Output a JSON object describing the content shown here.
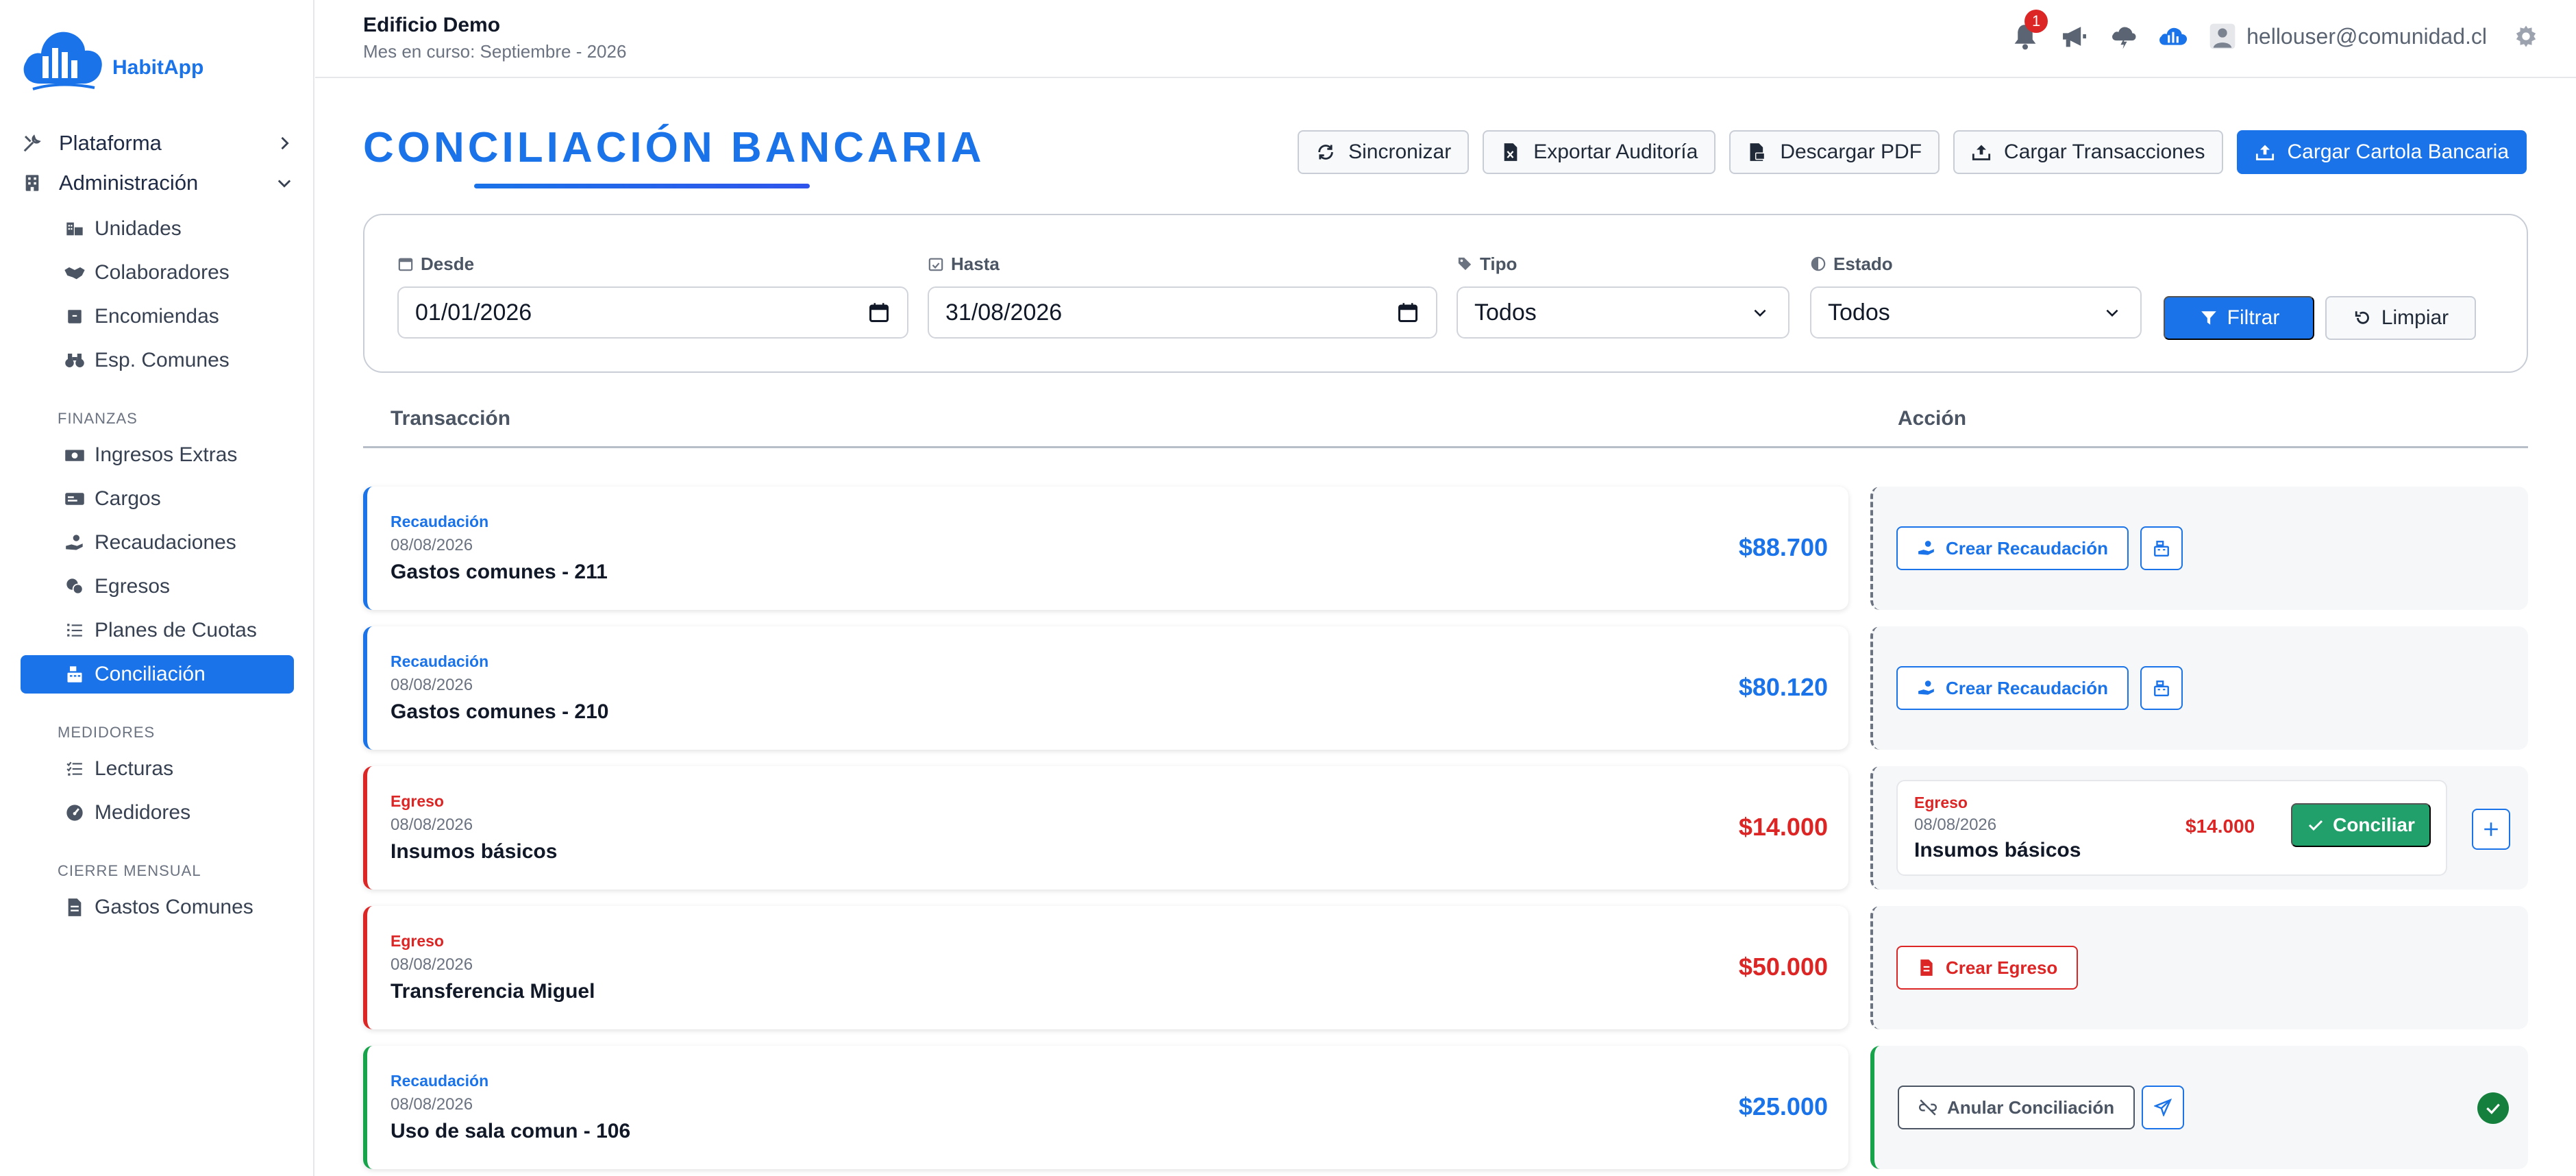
{
  "app": {
    "logo_text": "HabitApp",
    "brand_color": "#1a73e8"
  },
  "header": {
    "building": "Edificio Demo",
    "current_month": "Mes en curso: Septiembre - 2026",
    "notifications_count": "1",
    "user_email": "hellouser@comunidad.cl"
  },
  "sidebar": {
    "top": [
      {
        "label": "Plataforma",
        "icon": "tools-icon",
        "state": "collapsed"
      },
      {
        "label": "Administración",
        "icon": "building-icon",
        "state": "expanded"
      }
    ],
    "admin_items": [
      {
        "label": "Unidades",
        "icon": "units-icon"
      },
      {
        "label": "Colaboradores",
        "icon": "handshake-icon"
      },
      {
        "label": "Encomiendas",
        "icon": "package-icon"
      },
      {
        "label": "Esp. Comunes",
        "icon": "binoculars-icon"
      }
    ],
    "finanzas_label": "FINANZAS",
    "finanzas_items": [
      {
        "label": "Ingresos Extras",
        "icon": "money-icon"
      },
      {
        "label": "Cargos",
        "icon": "card-icon"
      },
      {
        "label": "Recaudaciones",
        "icon": "hand-coin-icon"
      },
      {
        "label": "Egresos",
        "icon": "coins-icon"
      },
      {
        "label": "Planes de Cuotas",
        "icon": "list-icon"
      },
      {
        "label": "Conciliación",
        "icon": "cash-register-icon",
        "active": true
      }
    ],
    "medidores_label": "MEDIDORES",
    "medidores_items": [
      {
        "label": "Lecturas",
        "icon": "checklist-icon"
      },
      {
        "label": "Medidores",
        "icon": "gauge-icon"
      }
    ],
    "cierre_label": "CIERRE MENSUAL",
    "cierre_items": [
      {
        "label": "Gastos Comunes",
        "icon": "invoice-icon"
      }
    ]
  },
  "page": {
    "title": "CONCILIACIÓN BANCARIA",
    "actions": {
      "sync": "Sincronizar",
      "export": "Exportar Auditoría",
      "pdf": "Descargar PDF",
      "upload_tx": "Cargar Transacciones",
      "upload_statement": "Cargar Cartola Bancaria"
    }
  },
  "filters": {
    "from_label": "Desde",
    "from_value": "01/01/2026",
    "to_label": "Hasta",
    "to_value": "31/08/2026",
    "type_label": "Tipo",
    "type_value": "Todos",
    "status_label": "Estado",
    "status_value": "Todos",
    "filter_button": "Filtrar",
    "clear_button": "Limpiar"
  },
  "table": {
    "col_transaction": "Transacción",
    "col_action": "Acción",
    "rows": [
      {
        "type": "Recaudación",
        "date": "08/08/2026",
        "desc": "Gastos comunes - 211",
        "amount": "$88.700",
        "kind": "income",
        "action": "Crear Recaudación"
      },
      {
        "type": "Recaudación",
        "date": "08/08/2026",
        "desc": "Gastos comunes - 210",
        "amount": "$80.120",
        "kind": "income",
        "action": "Crear Recaudación"
      },
      {
        "type": "Egreso",
        "date": "08/08/2026",
        "desc": "Insumos básicos",
        "amount": "$14.000",
        "kind": "expense",
        "match": {
          "type": "Egreso",
          "date": "08/08/2026",
          "desc": "Insumos básicos",
          "amount": "$14.000",
          "button": "Conciliar"
        }
      },
      {
        "type": "Egreso",
        "date": "08/08/2026",
        "desc": "Transferencia Miguel",
        "amount": "$50.000",
        "kind": "expense",
        "action": "Crear Egreso"
      },
      {
        "type": "Recaudación",
        "date": "08/08/2026",
        "desc": "Uso de sala comun - 106",
        "amount": "$25.000",
        "kind": "income",
        "action": "Anular Conciliación",
        "status": "reconciled"
      }
    ]
  }
}
